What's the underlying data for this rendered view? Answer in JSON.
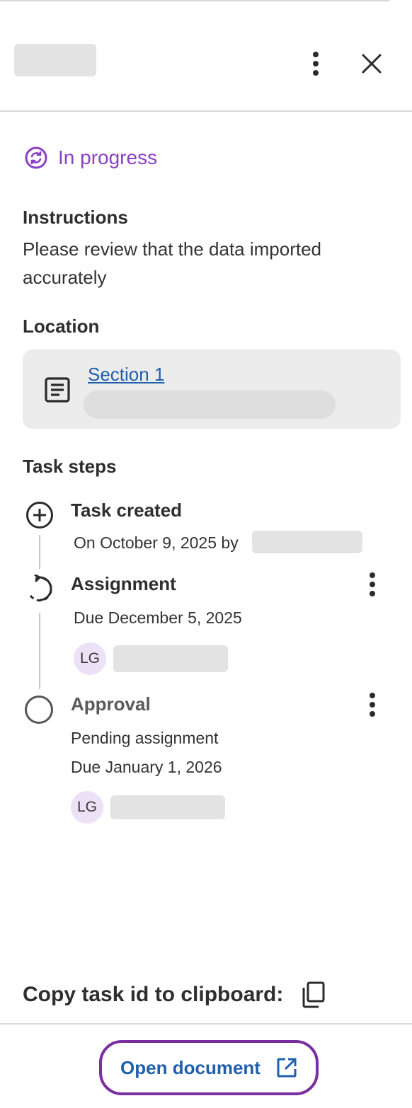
{
  "header": {
    "more_icon": "more-vertical-icon",
    "close_icon": "close-icon"
  },
  "status": {
    "label": "In progress",
    "icon": "sync-icon",
    "color": "#8a3fc4"
  },
  "instructions": {
    "heading": "Instructions",
    "text": "Please review that the data imported accurately"
  },
  "location": {
    "heading": "Location",
    "link_label": "Section 1",
    "icon": "document-icon"
  },
  "task_steps": {
    "heading": "Task steps",
    "steps": [
      {
        "title": "Task created",
        "detail": "On October 9, 2025 by",
        "icon": "add-circle-icon"
      },
      {
        "title": "Assignment",
        "detail": "Due December 5, 2025",
        "avatar": "LG",
        "icon": "in-progress-icon"
      },
      {
        "title": "Approval",
        "status": "Pending assignment",
        "detail": "Due January 1, 2026",
        "avatar": "LG",
        "icon": "pending-circle-icon"
      }
    ]
  },
  "copy": {
    "label": "Copy task id to clipboard:",
    "icon": "copy-icon"
  },
  "footer": {
    "open_label": "Open document",
    "icon": "external-link-icon",
    "accent": "#7b2ea0",
    "link_color": "#1f5fae"
  }
}
